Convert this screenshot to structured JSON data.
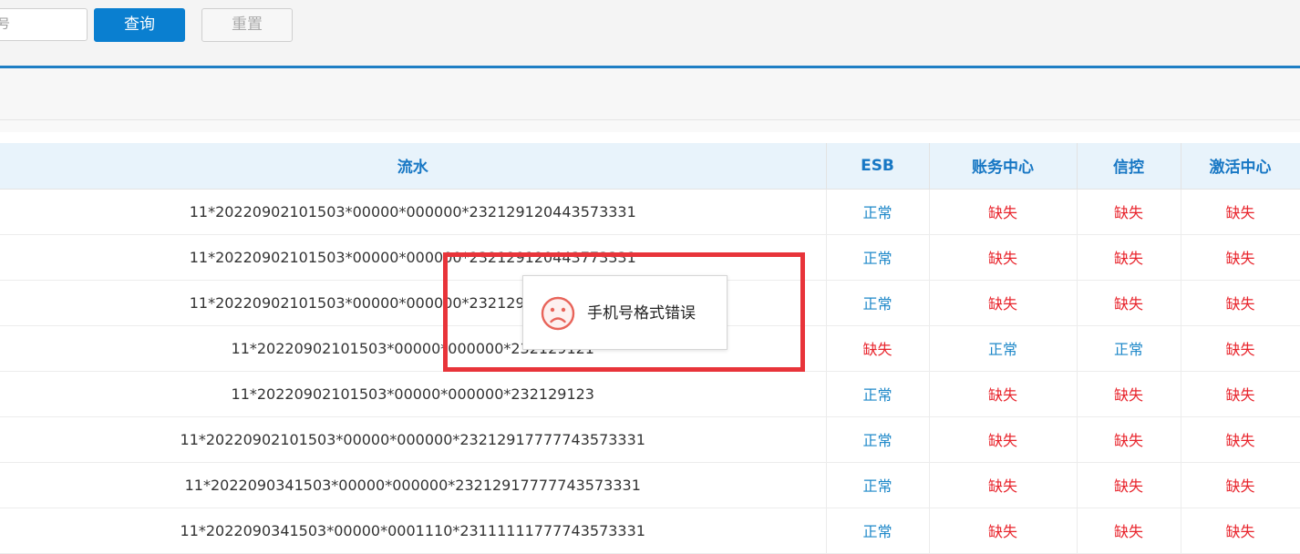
{
  "search": {
    "input_value": "号",
    "query_label": "查询",
    "reset_label": "重置"
  },
  "table": {
    "headers": [
      "流水",
      "ESB",
      "账务中心",
      "信控",
      "激活中心"
    ],
    "rows": [
      {
        "serial": "11*20220902101503*00000*000000*232129120443573331",
        "esb": "正常",
        "accounting": "缺失",
        "credit": "缺失",
        "activation": "缺失"
      },
      {
        "serial": "11*20220902101503*00000*000000*232129120443773331",
        "esb": "正常",
        "accounting": "缺失",
        "credit": "缺失",
        "activation": "缺失"
      },
      {
        "serial": "11*20220902101503*00000*000000*232129120443873331",
        "esb": "正常",
        "accounting": "缺失",
        "credit": "缺失",
        "activation": "缺失"
      },
      {
        "serial": "11*20220902101503*00000*000000*232129121",
        "esb": "缺失",
        "accounting": "正常",
        "credit": "正常",
        "activation": "缺失"
      },
      {
        "serial": "11*20220902101503*00000*000000*232129123",
        "esb": "正常",
        "accounting": "缺失",
        "credit": "缺失",
        "activation": "缺失"
      },
      {
        "serial": "11*20220902101503*00000*000000*23212917777743573331",
        "esb": "正常",
        "accounting": "缺失",
        "credit": "缺失",
        "activation": "缺失"
      },
      {
        "serial": "11*2022090341503*00000*000000*23212917777743573331",
        "esb": "正常",
        "accounting": "缺失",
        "credit": "缺失",
        "activation": "缺失"
      },
      {
        "serial": "11*2022090341503*00000*0001110*23111111777743573331",
        "esb": "正常",
        "accounting": "缺失",
        "credit": "缺失",
        "activation": "缺失"
      }
    ]
  },
  "toast": {
    "icon": "sad-face-icon",
    "message": "手机号格式错误"
  },
  "colors": {
    "primary": "#0a7fd0",
    "header_text": "#1777c4",
    "status_ok": "#1e88c9",
    "status_missing": "#e8242c",
    "highlight": "#e8343a"
  }
}
